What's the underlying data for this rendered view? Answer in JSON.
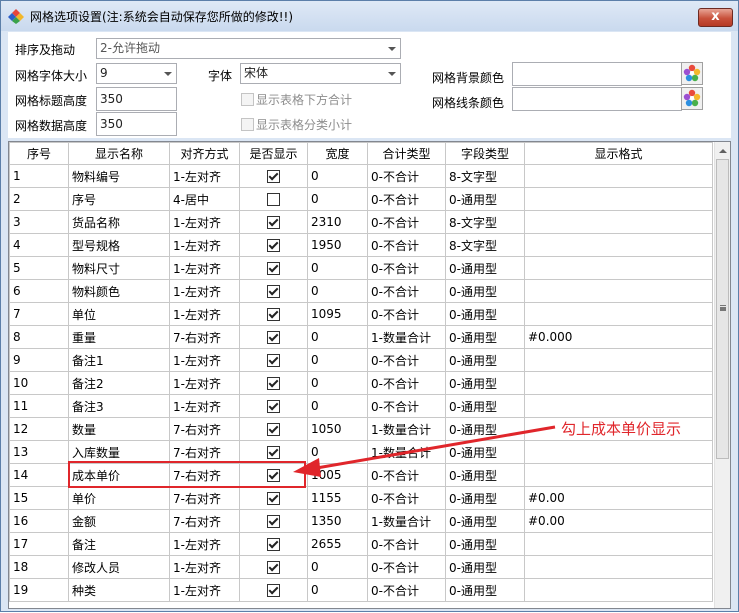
{
  "window": {
    "title": "网格选项设置(注:系统会自动保存您所做的修改!!)",
    "close_label": "x"
  },
  "settings": {
    "sort_drag": {
      "label": "排序及拖动",
      "value": "2-允许拖动"
    },
    "font_size": {
      "label": "网格字体大小",
      "value": "9"
    },
    "font": {
      "label": "字体",
      "value": "宋体"
    },
    "title_height": {
      "label": "网格标题高度",
      "value": "350"
    },
    "data_height": {
      "label": "网格数据高度",
      "value": "350"
    },
    "show_total_label": "显示表格下方合计",
    "show_subtotal_label": "显示表格分类小计",
    "bg_color_label": "网格背景颜色",
    "line_color_label": "网格线条颜色"
  },
  "table": {
    "columns": [
      "序号",
      "显示名称",
      "对齐方式",
      "是否显示",
      "宽度",
      "合计类型",
      "字段类型",
      "显示格式"
    ],
    "rows": [
      {
        "no": "1",
        "name": "物料编号",
        "align": "1-左对齐",
        "show": true,
        "width": "0",
        "total": "0-不合计",
        "type": "8-文字型",
        "fmt": ""
      },
      {
        "no": "2",
        "name": "序号",
        "align": "4-居中",
        "show": false,
        "width": "0",
        "total": "0-不合计",
        "type": "0-通用型",
        "fmt": ""
      },
      {
        "no": "3",
        "name": "货品名称",
        "align": "1-左对齐",
        "show": true,
        "width": "2310",
        "total": "0-不合计",
        "type": "8-文字型",
        "fmt": ""
      },
      {
        "no": "4",
        "name": "型号规格",
        "align": "1-左对齐",
        "show": true,
        "width": "1950",
        "total": "0-不合计",
        "type": "8-文字型",
        "fmt": ""
      },
      {
        "no": "5",
        "name": "物料尺寸",
        "align": "1-左对齐",
        "show": true,
        "width": "0",
        "total": "0-不合计",
        "type": "0-通用型",
        "fmt": ""
      },
      {
        "no": "6",
        "name": "物料颜色",
        "align": "1-左对齐",
        "show": true,
        "width": "0",
        "total": "0-不合计",
        "type": "0-通用型",
        "fmt": ""
      },
      {
        "no": "7",
        "name": "单位",
        "align": "1-左对齐",
        "show": true,
        "width": "1095",
        "total": "0-不合计",
        "type": "0-通用型",
        "fmt": ""
      },
      {
        "no": "8",
        "name": "重量",
        "align": "7-右对齐",
        "show": true,
        "width": "0",
        "total": "1-数量合计",
        "type": "0-通用型",
        "fmt": "#0.000"
      },
      {
        "no": "9",
        "name": "备注1",
        "align": "1-左对齐",
        "show": true,
        "width": "0",
        "total": "0-不合计",
        "type": "0-通用型",
        "fmt": ""
      },
      {
        "no": "10",
        "name": "备注2",
        "align": "1-左对齐",
        "show": true,
        "width": "0",
        "total": "0-不合计",
        "type": "0-通用型",
        "fmt": ""
      },
      {
        "no": "11",
        "name": "备注3",
        "align": "1-左对齐",
        "show": true,
        "width": "0",
        "total": "0-不合计",
        "type": "0-通用型",
        "fmt": ""
      },
      {
        "no": "12",
        "name": "数量",
        "align": "7-右对齐",
        "show": true,
        "width": "1050",
        "total": "1-数量合计",
        "type": "0-通用型",
        "fmt": ""
      },
      {
        "no": "13",
        "name": "入库数量",
        "align": "7-右对齐",
        "show": true,
        "width": "0",
        "total": "1-数量合计",
        "type": "0-通用型",
        "fmt": ""
      },
      {
        "no": "14",
        "name": "成本单价",
        "align": "7-右对齐",
        "show": true,
        "width": "1005",
        "total": "0-不合计",
        "type": "0-通用型",
        "fmt": ""
      },
      {
        "no": "15",
        "name": "单价",
        "align": "7-右对齐",
        "show": true,
        "width": "1155",
        "total": "0-不合计",
        "type": "0-通用型",
        "fmt": "#0.00"
      },
      {
        "no": "16",
        "name": "金额",
        "align": "7-右对齐",
        "show": true,
        "width": "1350",
        "total": "1-数量合计",
        "type": "0-通用型",
        "fmt": "#0.00"
      },
      {
        "no": "17",
        "name": "备注",
        "align": "1-左对齐",
        "show": true,
        "width": "2655",
        "total": "0-不合计",
        "type": "0-通用型",
        "fmt": ""
      },
      {
        "no": "18",
        "name": "修改人员",
        "align": "1-左对齐",
        "show": true,
        "width": "0",
        "total": "0-不合计",
        "type": "0-通用型",
        "fmt": ""
      },
      {
        "no": "19",
        "name": "种类",
        "align": "1-左对齐",
        "show": true,
        "width": "0",
        "total": "0-不合计",
        "type": "0-通用型",
        "fmt": ""
      }
    ]
  },
  "annotation": {
    "text": "勾上成本单价显示",
    "color": "#e0262b"
  }
}
